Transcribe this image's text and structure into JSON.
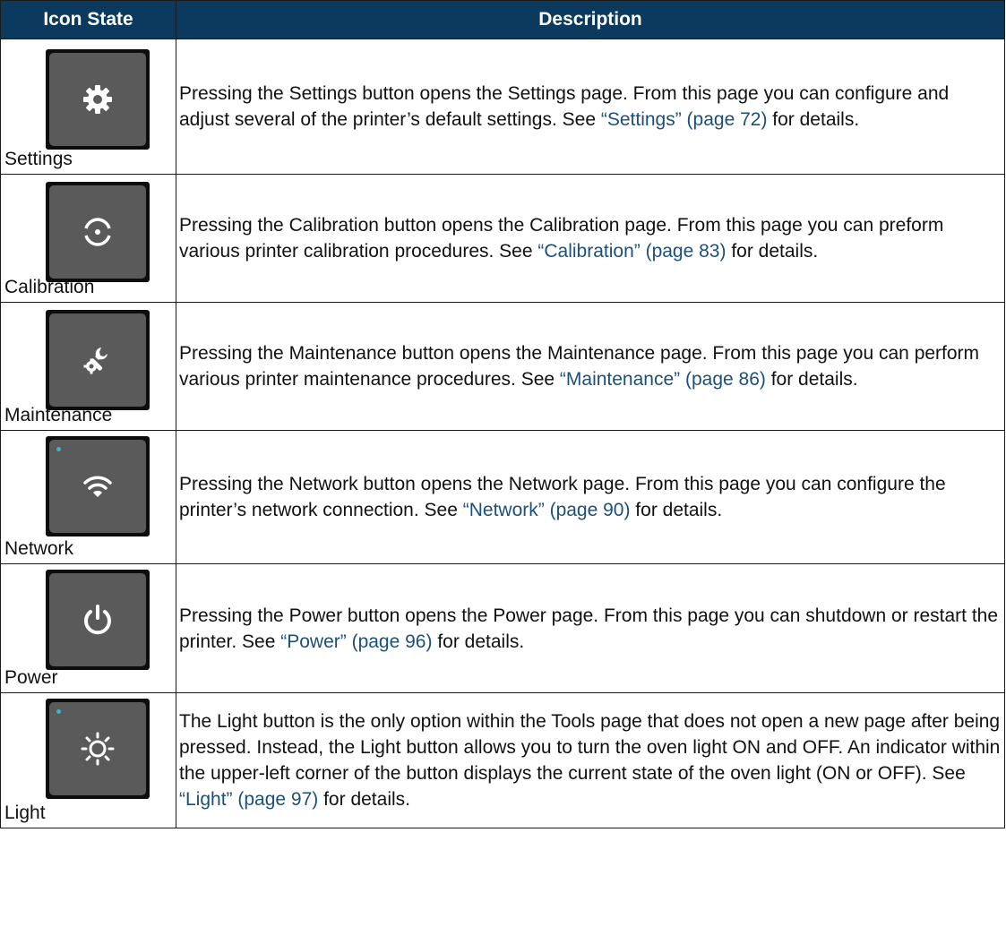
{
  "header": {
    "col_icon": "Icon State",
    "col_desc": "Description"
  },
  "rows": [
    {
      "icon": "gear-icon",
      "label": "Settings",
      "indicator": false,
      "desc_before": "Pressing the Settings button opens the Settings page. From this page you can configure and adjust several of the printer’s default settings. See ",
      "link": "“Settings” (page 72)",
      "desc_after": " for details."
    },
    {
      "icon": "calibration-target-icon",
      "label": "Calibration",
      "indicator": false,
      "desc_before": "Pressing the Calibration button opens the Calibration page. From this page you can preform various printer calibration procedures. See ",
      "link": "“Calibration” (page 83)",
      "desc_after": " for details."
    },
    {
      "icon": "wrench-gear-icon",
      "label": "Maintenance",
      "indicator": false,
      "desc_before": "Pressing the Maintenance button opens the Maintenance page. From this page you can perform various printer maintenance procedures. See ",
      "link": "“Maintenance” (page 86)",
      "desc_after": " for details."
    },
    {
      "icon": "wifi-icon",
      "label": "Network",
      "indicator": true,
      "desc_before": "Pressing the Network button opens the Network page. From this page you can configure the printer’s network connection. See ",
      "link": "“Network” (page 90)",
      "desc_after": " for details."
    },
    {
      "icon": "power-icon",
      "label": "Power",
      "indicator": false,
      "desc_before": "Pressing the Power button opens the Power page. From this page you can shutdown or restart the printer. See ",
      "link": "“Power” (page 96)",
      "desc_after": " for details."
    },
    {
      "icon": "sun-light-icon",
      "label": "Light",
      "indicator": true,
      "desc_before": "The Light button is the only option within the Tools page that does not open a new page after being pressed. Instead, the Light button allows you to turn the oven light ON and OFF. An indicator within the upper-left corner of the button displays the current state of the oven light (ON or OFF). See ",
      "link": "“Light” (page 97)",
      "desc_after": " for details."
    }
  ],
  "colors": {
    "header_bg": "#0b3a5e",
    "link": "#1c4f7a",
    "button_face": "#5a5a5a",
    "indicator": "#39b8c4"
  }
}
